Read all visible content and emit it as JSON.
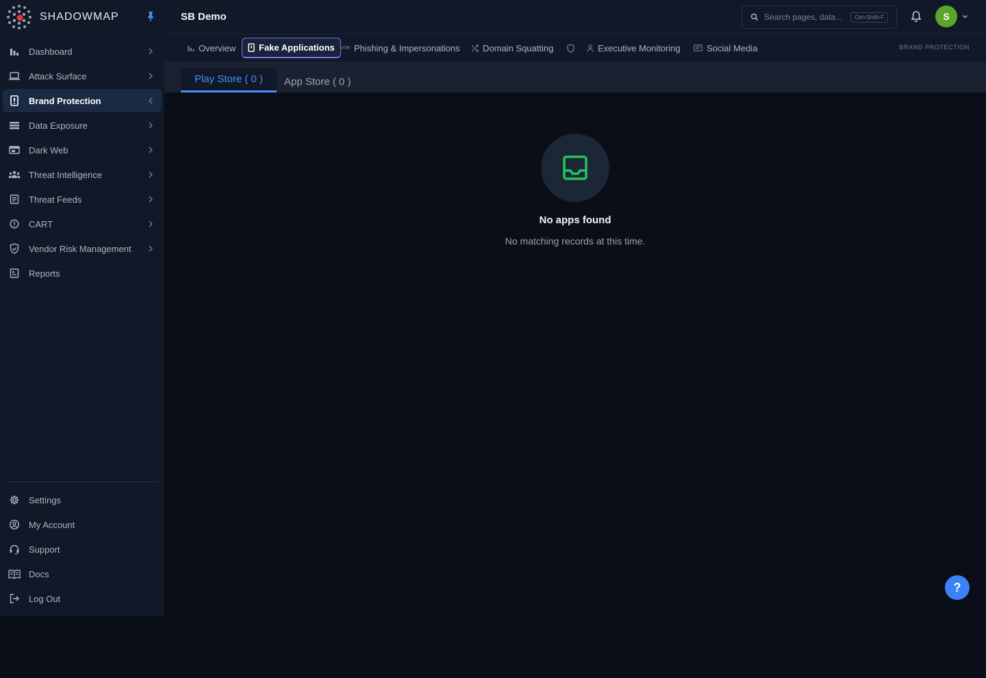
{
  "brand": {
    "name": "SHADOWMAP"
  },
  "header": {
    "org_title": "SB Demo",
    "search_placeholder": "Search pages, data...",
    "search_shortcut": "Ctrl+Shift+F",
    "avatar_initial": "S"
  },
  "sidebar": {
    "items": [
      {
        "label": "Dashboard",
        "icon": "bar-chart-icon"
      },
      {
        "label": "Attack Surface",
        "icon": "laptop-icon"
      },
      {
        "label": "Brand Protection",
        "icon": "mobile-icon"
      },
      {
        "label": "Data Exposure",
        "icon": "database-icon"
      },
      {
        "label": "Dark Web",
        "icon": "dark-web-icon"
      },
      {
        "label": "Threat Intelligence",
        "icon": "people-icon"
      },
      {
        "label": "Threat Feeds",
        "icon": "document-icon"
      },
      {
        "label": "CART",
        "icon": "alert-circle-icon"
      },
      {
        "label": "Vendor Risk Management",
        "icon": "shield-check-icon"
      },
      {
        "label": "Reports",
        "icon": "report-icon"
      }
    ],
    "bottom_items": [
      {
        "label": "Settings",
        "icon": "gear-icon"
      },
      {
        "label": "My Account",
        "icon": "user-circle-icon"
      },
      {
        "label": "Support",
        "icon": "headset-icon"
      },
      {
        "label": "Docs",
        "icon": "book-icon"
      },
      {
        "label": "Log Out",
        "icon": "logout-icon"
      }
    ]
  },
  "tabs": [
    {
      "label": "Overview",
      "icon": "bar-chart-icon"
    },
    {
      "label": "Fake Applications",
      "icon": "mobile-icon"
    },
    {
      "label": "Phishing & Impersonations",
      "icon": "http-icon"
    },
    {
      "label": "Domain Squatting",
      "icon": "shuffle-icon"
    },
    {
      "label": "",
      "icon": "shield-icon"
    },
    {
      "label": "Executive Monitoring",
      "icon": "person-icon"
    },
    {
      "label": "Social Media",
      "icon": "message-icon"
    }
  ],
  "section_label": "BRAND PROTECTION",
  "subtabs": [
    {
      "label": "Play Store ( 0 )"
    },
    {
      "label": "App Store ( 0 )"
    }
  ],
  "empty_state": {
    "title": "No apps found",
    "subtitle": "No matching records at this time.",
    "icon": "inbox-icon"
  },
  "help_button": "?",
  "colors": {
    "accent": "#4a8dff",
    "active_tab_border": "#7b6cf0",
    "empty_icon": "#22c55e",
    "avatar": "#5aa52a"
  }
}
